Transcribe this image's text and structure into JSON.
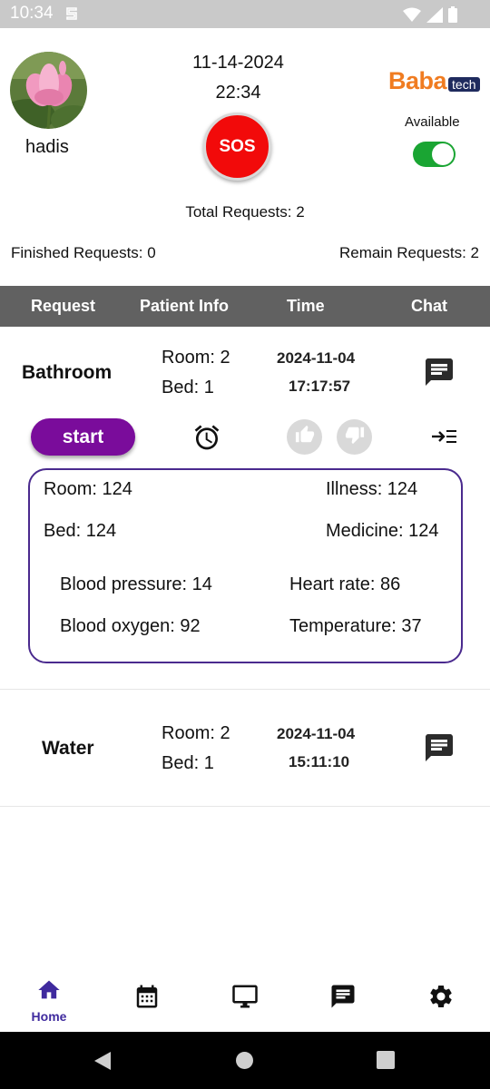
{
  "status_bar": {
    "time": "10:34"
  },
  "profile": {
    "name": "hadis"
  },
  "header": {
    "date": "11-14-2024",
    "clock": "22:34",
    "sos_label": "SOS"
  },
  "brand": {
    "name_part1": "Baba",
    "name_part2": "tech"
  },
  "availability": {
    "label": "Available",
    "on": true
  },
  "summary": {
    "total": "Total Requests: 2",
    "finished": "Finished Requests: 0",
    "remain": "Remain Requests: 2"
  },
  "table_headers": [
    "Request",
    "Patient Info",
    "Time",
    "Chat"
  ],
  "requests": [
    {
      "title": "Bathroom",
      "room": "Room: 2",
      "bed": "Bed: 1",
      "date": "2024-11-04",
      "time": "17:17:57",
      "start_label": "start",
      "details": {
        "room": "Room: 124",
        "illness": "Illness: 124",
        "bed": "Bed: 124",
        "medicine": "Medicine: 124",
        "blood_pressure": "Blood pressure: 14",
        "heart_rate": "Heart rate: 86",
        "blood_oxygen": "Blood oxygen: 92",
        "temperature": "Temperature: 37"
      }
    },
    {
      "title": "Water",
      "room": "Room: 2",
      "bed": "Bed: 1",
      "date": "2024-11-04",
      "time": "15:11:10"
    }
  ],
  "bottom_nav": [
    {
      "icon": "home-icon",
      "label": "Home",
      "active": true
    },
    {
      "icon": "calendar-icon",
      "label": ""
    },
    {
      "icon": "monitor-icon",
      "label": ""
    },
    {
      "icon": "chat-icon",
      "label": ""
    },
    {
      "icon": "gear-icon",
      "label": ""
    }
  ],
  "colors": {
    "accent": "#3f2a9e",
    "sos": "#f20a0a",
    "start_button": "#7a0c9b",
    "toggle_on": "#1aa533",
    "table_header": "#616161",
    "card_border": "#4a2a8e",
    "brand_orange": "#f07c21",
    "brand_navy": "#1f2b5e"
  }
}
